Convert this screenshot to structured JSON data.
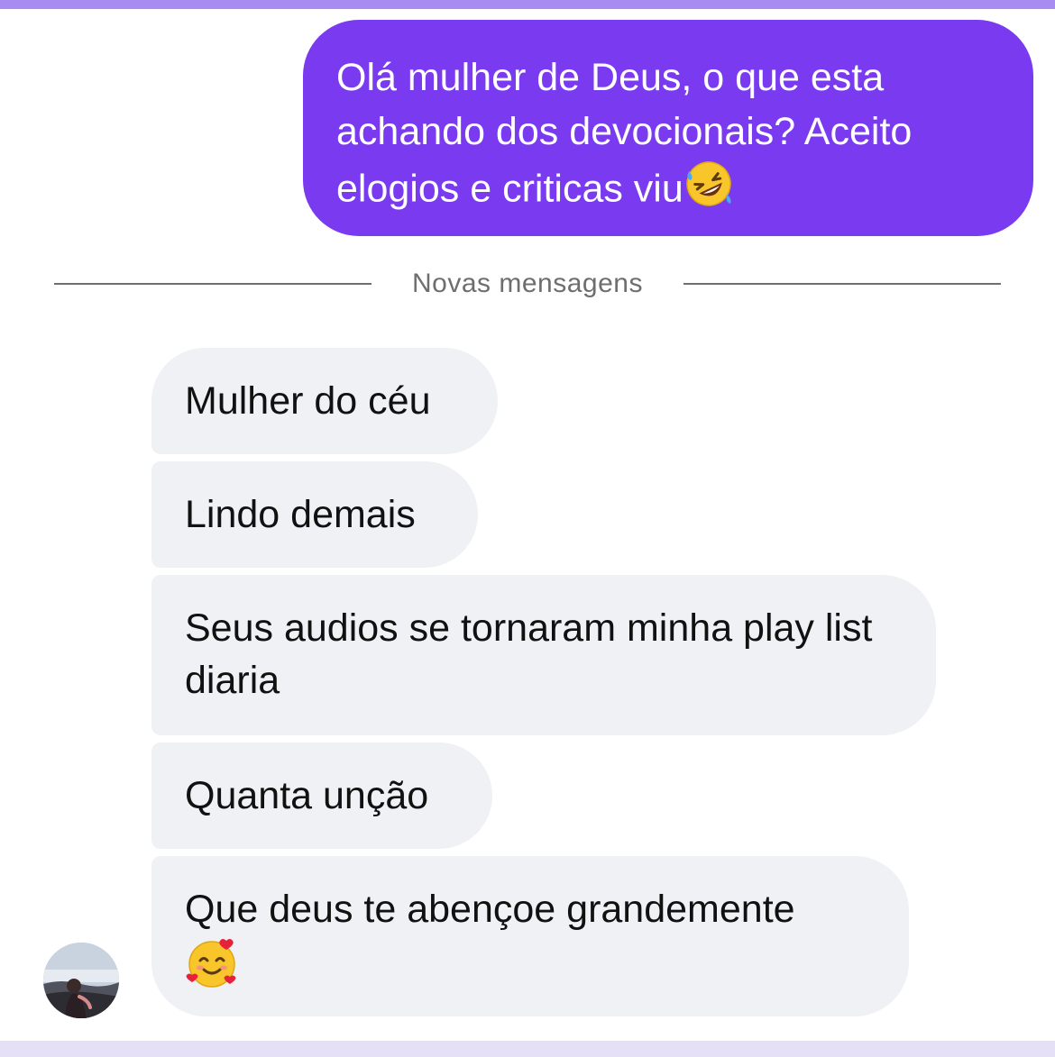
{
  "colors": {
    "sent_bubble": "#7a3af0",
    "received_bubble": "#eff1f4",
    "divider": "#6f6f6f",
    "top_accent": "#a98cf2"
  },
  "sent_message": {
    "text": "Olá mulher de Deus, o que esta achando dos devocionais? Aceito elogios e criticas viu",
    "emoji": "rolling-on-floor-laughing-emoji"
  },
  "divider": {
    "label": "Novas mensagens"
  },
  "received_messages": [
    {
      "text": "Mulher do céu"
    },
    {
      "text": "Lindo demais"
    },
    {
      "text": "Seus audios se tornaram minha play list diaria"
    },
    {
      "text": "Quanta unção"
    },
    {
      "text": "Que deus te abençoe grandemente",
      "emoji": "smiling-face-with-hearts-emoji"
    }
  ],
  "sender": {
    "avatar_icon": "user-avatar"
  }
}
